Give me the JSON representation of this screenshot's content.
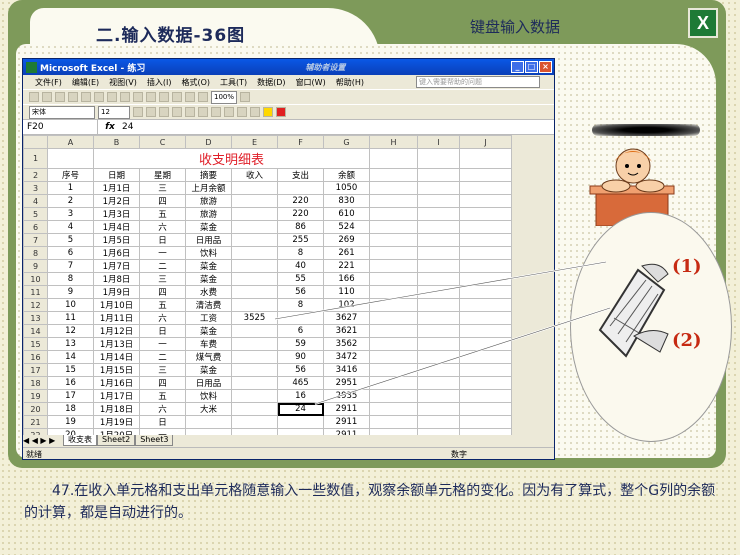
{
  "slide": {
    "title": "二.输入数据-36图",
    "right_title": "键盘输入数据",
    "excel_badge": "X",
    "caption_number": "47.",
    "caption_text": "在收入单元格和支出单元格随意输入一些数值，观察余额单元格的变化。因为有了算式，整个G列的余额的计算，都是自动进行的。",
    "labels": [
      "(1)",
      "(2)"
    ]
  },
  "excel": {
    "window_title": "Microsoft Excel - 练习",
    "window_overlay": "辅助者设置",
    "menu": [
      "文件(F)",
      "编辑(E)",
      "视图(V)",
      "插入(I)",
      "格式(O)",
      "工具(T)",
      "数据(D)",
      "窗口(W)",
      "帮助(H)"
    ],
    "help_placeholder": "键入需要帮助的问题",
    "font_name": "宋体",
    "font_size": "12",
    "zoom": "100%",
    "name_box": "F20",
    "fx": "fx",
    "formula_value": "24",
    "columns": [
      "A",
      "B",
      "C",
      "D",
      "E",
      "F",
      "G",
      "H",
      "I",
      "J"
    ],
    "sheet_title": "收支明细表",
    "headers": [
      "序号",
      "日期",
      "星期",
      "摘要",
      "收入",
      "支出",
      "余额"
    ],
    "rows": [
      [
        "1",
        "1月1日",
        "三",
        "上月余额",
        "",
        "",
        "1050"
      ],
      [
        "2",
        "1月2日",
        "四",
        "旅游",
        "",
        "220",
        "830"
      ],
      [
        "3",
        "1月3日",
        "五",
        "旅游",
        "",
        "220",
        "610"
      ],
      [
        "4",
        "1月4日",
        "六",
        "菜金",
        "",
        "86",
        "524"
      ],
      [
        "5",
        "1月5日",
        "日",
        "日用品",
        "",
        "255",
        "269"
      ],
      [
        "6",
        "1月6日",
        "一",
        "饮料",
        "",
        "8",
        "261"
      ],
      [
        "7",
        "1月7日",
        "二",
        "菜金",
        "",
        "40",
        "221"
      ],
      [
        "8",
        "1月8日",
        "三",
        "菜金",
        "",
        "55",
        "166"
      ],
      [
        "9",
        "1月9日",
        "四",
        "水费",
        "",
        "56",
        "110"
      ],
      [
        "10",
        "1月10日",
        "五",
        "清洁费",
        "",
        "8",
        "102"
      ],
      [
        "11",
        "1月11日",
        "六",
        "工资",
        "3525",
        "",
        "3627"
      ],
      [
        "12",
        "1月12日",
        "日",
        "菜金",
        "",
        "6",
        "3621"
      ],
      [
        "13",
        "1月13日",
        "一",
        "车费",
        "",
        "59",
        "3562"
      ],
      [
        "14",
        "1月14日",
        "二",
        "煤气费",
        "",
        "90",
        "3472"
      ],
      [
        "15",
        "1月15日",
        "三",
        "菜金",
        "",
        "56",
        "3416"
      ],
      [
        "16",
        "1月16日",
        "四",
        "日用品",
        "",
        "465",
        "2951"
      ],
      [
        "17",
        "1月17日",
        "五",
        "饮料",
        "",
        "16",
        "2935"
      ],
      [
        "18",
        "1月18日",
        "六",
        "大米",
        "",
        "24",
        "2911"
      ],
      [
        "19",
        "1月19日",
        "日",
        "",
        "",
        "",
        "2911"
      ],
      [
        "20",
        "1月20日",
        "一",
        "",
        "",
        "",
        "2911"
      ]
    ],
    "sheet_tabs": [
      "收支表",
      "Sheet2",
      "Sheet3"
    ],
    "status_left": "就绪",
    "status_right": "数字"
  }
}
